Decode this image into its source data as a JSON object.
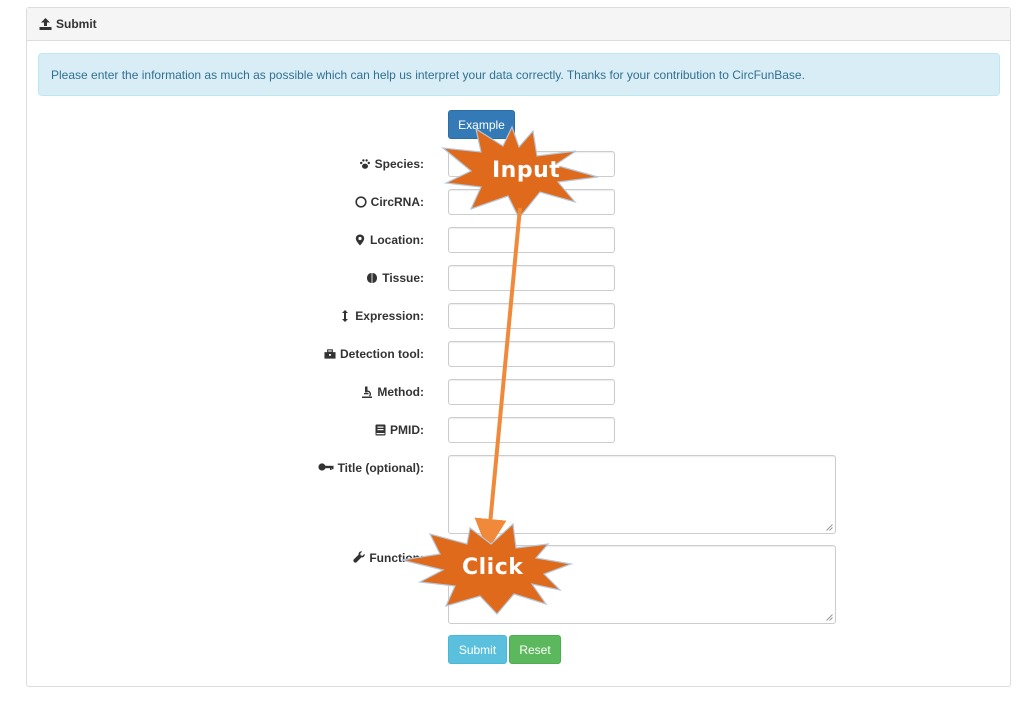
{
  "panel": {
    "title": "Submit",
    "title_icon": "upload-icon"
  },
  "alert": {
    "text": "Please enter the information as much as possible which can help us interpret your data correctly. Thanks for your contribution to CircFunBase."
  },
  "buttons": {
    "example": "Example",
    "submit": "Submit",
    "reset": "Reset"
  },
  "fields": [
    {
      "label": "Species:",
      "icon": "paw-icon",
      "value": ""
    },
    {
      "label": "CircRNA:",
      "icon": "circle-icon",
      "value": ""
    },
    {
      "label": "Location:",
      "icon": "map-marker-icon",
      "value": ""
    },
    {
      "label": "Tissue:",
      "icon": "brain-icon",
      "value": ""
    },
    {
      "label": "Expression:",
      "icon": "vertical-arrows-icon",
      "value": ""
    },
    {
      "label": "Detection tool:",
      "icon": "toolbox-icon",
      "value": ""
    },
    {
      "label": "Method:",
      "icon": "microscope-icon",
      "value": ""
    },
    {
      "label": "PMID:",
      "icon": "book-icon",
      "value": ""
    },
    {
      "label": "Title (optional):",
      "icon": "key-icon",
      "value": ""
    },
    {
      "label": "Function:",
      "icon": "wrench-icon",
      "value": ""
    }
  ],
  "annotations": {
    "input": "Input",
    "click": "Click"
  },
  "colors": {
    "primary": "#337ab7",
    "info": "#5bc0de",
    "success": "#5cb85c",
    "alert_bg": "#d9edf7",
    "alert_text": "#31708f",
    "annotation": "#e06a1b",
    "arrow": "#f08a3a"
  }
}
